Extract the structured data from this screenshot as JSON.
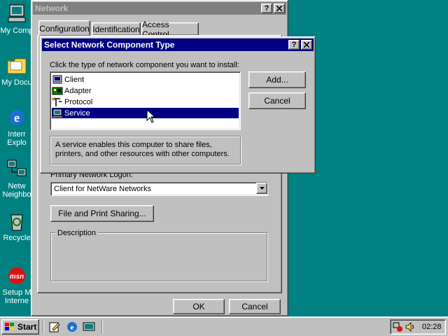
{
  "desktop": {
    "icons": [
      {
        "label": "My Comp"
      },
      {
        "label": "My Docu"
      },
      {
        "label": "Interr\nExplo"
      },
      {
        "label": "Netw\nNeighbo"
      },
      {
        "label": "Recycle"
      },
      {
        "label": "Setup M\nInterne"
      }
    ]
  },
  "network_window": {
    "title": "Network",
    "tabs": [
      "Configuration",
      "Identification",
      "Access Control"
    ],
    "primary_logon_label": "Primary Network Logon:",
    "primary_logon_value": "Client for NetWare Networks",
    "file_print_button": "File and Print Sharing...",
    "description_label": "Description",
    "ok_label": "OK",
    "cancel_label": "Cancel"
  },
  "dialog": {
    "title": "Select Network Component Type",
    "prompt": "Click the type of network component you want to install:",
    "items": [
      {
        "label": "Client",
        "icon": "client-icon"
      },
      {
        "label": "Adapter",
        "icon": "adapter-icon"
      },
      {
        "label": "Protocol",
        "icon": "protocol-icon"
      },
      {
        "label": "Service",
        "icon": "service-icon",
        "selected": true
      }
    ],
    "add_label": "Add...",
    "cancel_label": "Cancel",
    "description": "A service enables this computer to share files, printers, and other resources with other computers."
  },
  "taskbar": {
    "start_label": "Start",
    "clock": "02:28"
  },
  "colors": {
    "desktop": "#008080",
    "active_title": "#000080",
    "inactive_title": "#808080",
    "face": "#c0c0c0"
  }
}
